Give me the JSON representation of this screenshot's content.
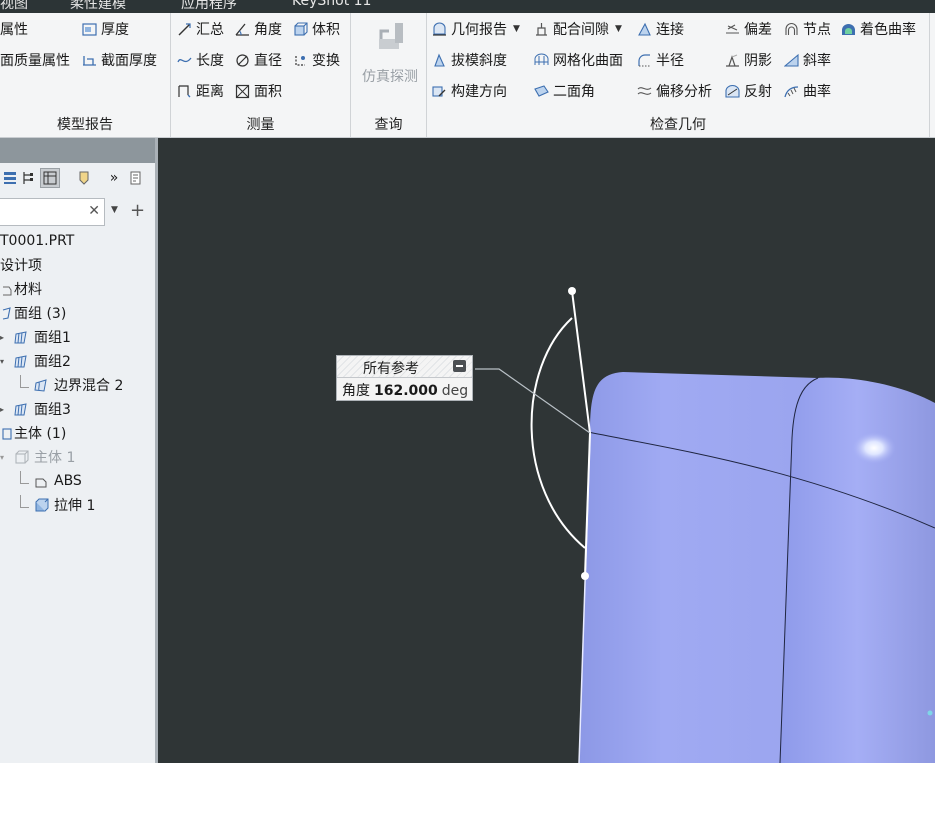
{
  "menu": {
    "items": [
      "视图",
      "柔性建模",
      "应用程序",
      "KeyShot 11"
    ]
  },
  "ribbon": {
    "groups": {
      "model_report": {
        "label": "模型报告",
        "buttons": {
          "properties": "属性",
          "thickness": "厚度",
          "mass_properties": "面质量属性",
          "section_thickness": "截面厚度"
        }
      },
      "measure": {
        "label": "测量",
        "buttons": {
          "summary": "汇总",
          "angle": "角度",
          "volume": "体积",
          "length": "长度",
          "diameter": "直径",
          "transform": "变换",
          "distance": "距离",
          "area": "面积"
        }
      },
      "query": {
        "label": "查询",
        "buttons": {
          "sim_probe": "仿真探测"
        }
      },
      "inspect_geometry": {
        "label": "检查几何",
        "buttons": {
          "geometry_report": "几何报告",
          "clearance": "配合间隙",
          "connect": "连接",
          "draft": "拔模斜度",
          "mesh_surface": "网格化曲面",
          "radius": "半径",
          "build_direction": "构建方向",
          "dihedral": "二面角",
          "offset_analysis": "偏移分析",
          "deviation": "偏差",
          "node": "节点",
          "shade_curvature": "着色曲率",
          "shadow": "阴影",
          "slope": "斜率",
          "reflection": "反射",
          "curvature": "曲率"
        }
      }
    }
  },
  "model_tree": {
    "search": {
      "value": "",
      "placeholder": ""
    },
    "items": [
      {
        "label": "T0001.PRT"
      },
      {
        "label": "设计项"
      },
      {
        "label": "材料"
      },
      {
        "label": "面组 (3)"
      },
      {
        "label": "面组1"
      },
      {
        "label": "面组2"
      },
      {
        "label": "边界混合 2"
      },
      {
        "label": "面组3"
      },
      {
        "label": "主体 (1)"
      },
      {
        "label": "主体 1"
      },
      {
        "label": "ABS"
      },
      {
        "label": "拉伸 1"
      }
    ]
  },
  "annotation": {
    "title": "所有参考",
    "measure_label": "角度",
    "value": "162.000",
    "unit": "deg"
  },
  "colors": {
    "viewport_bg": "#2f3536",
    "surface": "#9aa5f0",
    "ribbon_bg": "#f4f5f6",
    "tree_bg": "#edf0f3"
  }
}
